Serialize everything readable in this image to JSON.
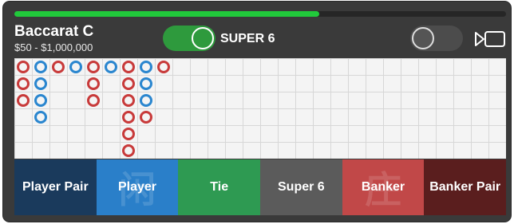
{
  "header": {
    "table_name": "Baccarat C",
    "limits": "$50 - $1,000,000",
    "progress": 0.62
  },
  "toggles": {
    "super6_label": "SUPER 6",
    "super6_on": true,
    "second_on": false
  },
  "icons": {
    "video": "video-camera-icon"
  },
  "colors": {
    "banker": "#c83a3a",
    "player": "#2a86cf",
    "progress": "#21c93b"
  },
  "road": {
    "columns": [
      [
        "B",
        "B",
        "B"
      ],
      [
        "P",
        "P",
        "P",
        "P"
      ],
      [
        "B"
      ],
      [
        "P"
      ],
      [
        "B",
        "B",
        "B"
      ],
      [
        "P"
      ],
      [
        "B",
        "B",
        "B",
        "B",
        "B",
        "B"
      ],
      [
        "P",
        "P",
        "P",
        "B"
      ],
      [
        "B"
      ]
    ]
  },
  "bets": [
    {
      "label": "Player Pair",
      "bg": "#1a3a5c",
      "watermark": ""
    },
    {
      "label": "Player",
      "bg": "#2a7fc9",
      "watermark": "闲"
    },
    {
      "label": "Tie",
      "bg": "#2e9a52",
      "watermark": ""
    },
    {
      "label": "Super 6",
      "bg": "#5b5b5b",
      "watermark": ""
    },
    {
      "label": "Banker",
      "bg": "#c14848",
      "watermark": "庄"
    },
    {
      "label": "Banker Pair",
      "bg": "#5a1e1e",
      "watermark": ""
    }
  ]
}
